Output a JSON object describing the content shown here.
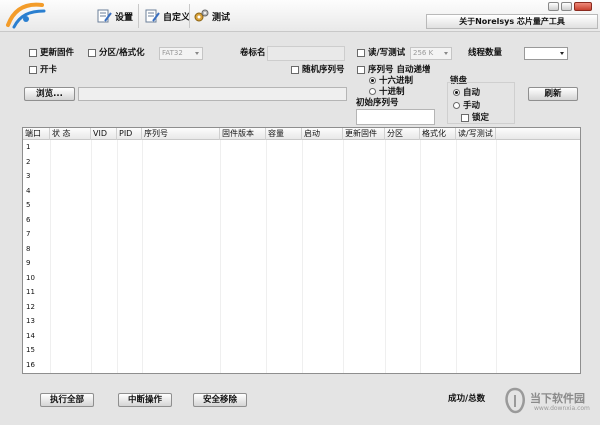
{
  "window": {
    "title": "关于Norelsys 芯片量产工具",
    "toolbar": [
      {
        "label": "设置",
        "icon": "settings-doc-icon"
      },
      {
        "label": "自定义",
        "icon": "custom-doc-icon"
      },
      {
        "label": "测试",
        "icon": "gears-icon"
      }
    ]
  },
  "options": {
    "update_firmware": "更新固件",
    "open_card": "开卡",
    "partition_format": "分区/格式化",
    "fs_select": "FAT32",
    "volume_label": "卷标名",
    "random_serial": "随机序列号",
    "rw_test": "读/写测试",
    "rw_size": "256 K",
    "thread_count": "线程数量",
    "serial_auto_inc": "序列号 自动递增",
    "hex": "十六进制",
    "dec": "十进制",
    "initial_serial": "初始序列号",
    "lock_group": "锁盘",
    "lock_auto": "自动",
    "lock_manual": "手动",
    "lock_lock": "锁定"
  },
  "buttons": {
    "browse": "浏览...",
    "refresh": "刷新",
    "run_all": "执行全部",
    "abort": "中断操作",
    "safe_remove": "安全移除"
  },
  "table": {
    "columns": [
      "端口",
      "状  态",
      "VID",
      "PID",
      "序列号",
      "固件版本",
      "容量",
      "启动",
      "更新固件",
      "分区",
      "格式化",
      "读/写测试"
    ],
    "rows": [
      "1",
      "2",
      "3",
      "4",
      "5",
      "6",
      "7",
      "8",
      "9",
      "10",
      "11",
      "12",
      "13",
      "14",
      "15",
      "16"
    ]
  },
  "status": {
    "success_total": "成功/总数"
  },
  "watermark": {
    "text": "当下软件园",
    "url": "www.downxia.com"
  },
  "colors": {
    "window_bg": "#e4e4e4",
    "close_button": "#c8412f",
    "logo_orange": "#f39c2a",
    "logo_blue": "#2a7fd0"
  }
}
